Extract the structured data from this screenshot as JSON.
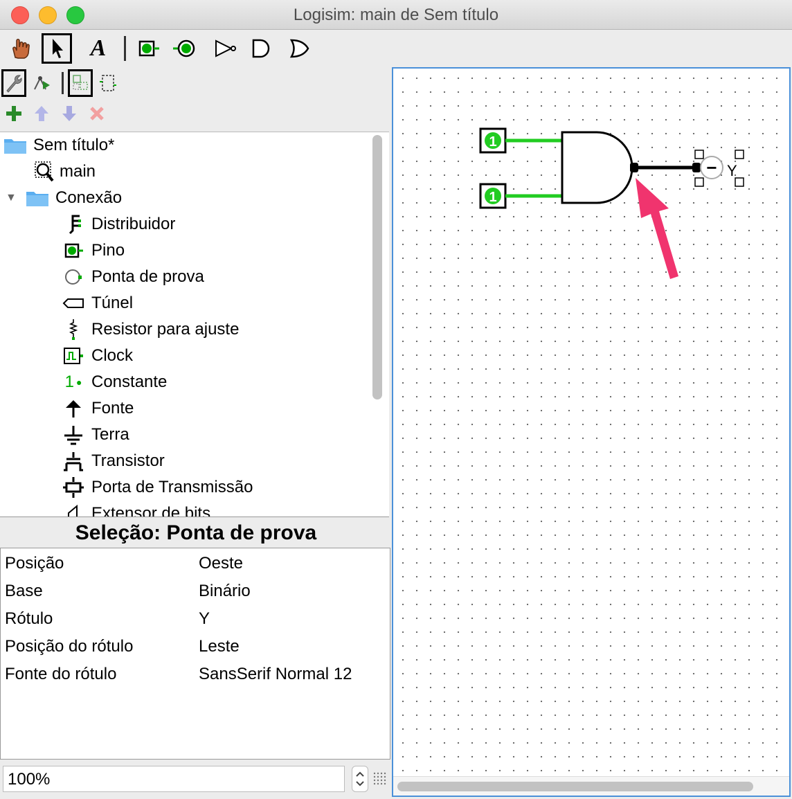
{
  "window": {
    "title": "Logisim: main de Sem título"
  },
  "toolbar": {
    "tools": [
      "poke-tool",
      "select-tool",
      "text-tool",
      "input-pin",
      "output-pin",
      "not-gate",
      "and-gate",
      "or-gate"
    ],
    "text_tool_label": "A"
  },
  "explorer": {
    "project": "Sem título*",
    "circuit": "main",
    "folder": "Conexão",
    "items": [
      {
        "label": "Distribuidor",
        "icon": "splitter-icon"
      },
      {
        "label": "Pino",
        "icon": "pin-icon"
      },
      {
        "label": "Ponta de prova",
        "icon": "probe-icon"
      },
      {
        "label": "Túnel",
        "icon": "tunnel-icon"
      },
      {
        "label": "Resistor para ajuste",
        "icon": "pull-resistor-icon"
      },
      {
        "label": "Clock",
        "icon": "clock-icon"
      },
      {
        "label": "Constante",
        "icon": "constant-icon"
      },
      {
        "label": "Fonte",
        "icon": "power-icon"
      },
      {
        "label": "Terra",
        "icon": "ground-icon"
      },
      {
        "label": "Transistor",
        "icon": "transistor-icon"
      },
      {
        "label": "Porta de Transmissão",
        "icon": "transmission-gate-icon"
      },
      {
        "label": "Extensor de bits",
        "icon": "bit-extender-icon"
      }
    ],
    "constant_glyph": "1"
  },
  "selection": {
    "title": "Seleção: Ponta de prova",
    "attributes": [
      {
        "key": "Posição",
        "value": "Oeste"
      },
      {
        "key": "Base",
        "value": "Binário"
      },
      {
        "key": "Rótulo",
        "value": "Y"
      },
      {
        "key": "Posição do rótulo",
        "value": "Leste"
      },
      {
        "key": "Fonte do rótulo",
        "value": "SansSerif Normal 12"
      }
    ]
  },
  "zoom": {
    "value": "100%"
  },
  "circuit": {
    "input_values": [
      "1",
      "1"
    ],
    "probe_label": "Y",
    "probe_value": "−",
    "colors": {
      "wire_on": "#22cc22",
      "wire_unknown": "#000000",
      "annotation_arrow": "#f0346e"
    }
  }
}
